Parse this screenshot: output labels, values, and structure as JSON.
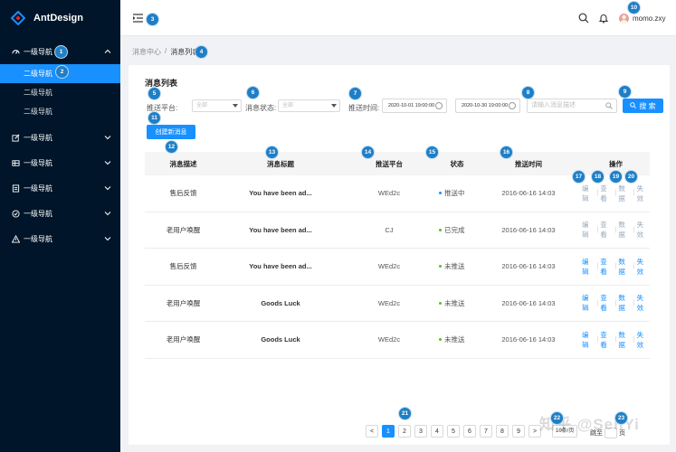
{
  "app": {
    "logo_text": "AntDesign",
    "brand_color": "#1890ff"
  },
  "sidebar": {
    "items": [
      {
        "label": "一级导航",
        "icon": "dashboard-icon",
        "expanded": true,
        "children": [
          {
            "label": "二级导航",
            "active": true
          },
          {
            "label": "二级导航"
          },
          {
            "label": "二级导航"
          }
        ]
      },
      {
        "label": "一级导航",
        "icon": "edit-icon"
      },
      {
        "label": "一级导航",
        "icon": "table-icon"
      },
      {
        "label": "一级导航",
        "icon": "profile-icon"
      },
      {
        "label": "一级导航",
        "icon": "check-circle-icon"
      },
      {
        "label": "一级导航",
        "icon": "warning-icon"
      }
    ]
  },
  "header": {
    "username": "momo.zxy"
  },
  "breadcrumb": {
    "parent": "消息中心",
    "separator": "/",
    "current": "消息列表"
  },
  "page": {
    "title": "消息列表"
  },
  "filters": {
    "platform_label": "推送平台:",
    "platform_placeholder": "全部",
    "status_label": "消息状态:",
    "status_placeholder": "全部",
    "time_label": "推送时间:",
    "start_time": "2020-10-01 19:00:00",
    "end_time": "2020-10-30 19:00:00",
    "search_placeholder": "请输入消息描述",
    "search_button": "搜 索"
  },
  "create_button": "创建新消息",
  "table": {
    "columns": [
      "消息描述",
      "消息标题",
      "推送平台",
      "状态",
      "推送时间",
      "操作"
    ],
    "rows": [
      {
        "desc": "售后反馈",
        "title": "You have been ad...",
        "platform": "WEd2c",
        "status": "推送中",
        "status_color": "#1890ff",
        "time": "2016-06-16  14:03",
        "actions_dim": true
      },
      {
        "desc": "老用户唤醒",
        "title": "You have been ad...",
        "platform": "CJ",
        "status": "已完成",
        "status_color": "#52c41a",
        "time": "2016-06-16  14:03",
        "actions_dim": true
      },
      {
        "desc": "售后反馈",
        "title": "You have been ad...",
        "platform": "WEd2c",
        "status": "未推送",
        "status_color": "#52c41a",
        "time": "2016-06-16  14:03",
        "actions_dim": false
      },
      {
        "desc": "老用户唤醒",
        "title": "Goods Luck",
        "platform": "WEd2c",
        "status": "未推送",
        "status_color": "#52c41a",
        "time": "2016-06-16  14:03",
        "actions_dim": false
      },
      {
        "desc": "老用户唤醒",
        "title": "Goods Luck",
        "platform": "WEd2c",
        "status": "未推送",
        "status_color": "#52c41a",
        "time": "2016-06-16  14:03",
        "actions_dim": false
      }
    ],
    "actions": [
      "编辑",
      "查看",
      "数据",
      "失效"
    ]
  },
  "pagination": {
    "prev": "<",
    "pages": [
      "1",
      "2",
      "3",
      "4",
      "5",
      "6",
      "7",
      "8",
      "9"
    ],
    "next": ">",
    "current": 1,
    "page_size": "10条/页",
    "goto_label": "跳至",
    "goto_suffix": "页"
  },
  "watermark": "知乎 @SenYi",
  "markers": [
    "1",
    "2",
    "3",
    "4",
    "5",
    "6",
    "7",
    "8",
    "9",
    "10",
    "11",
    "12",
    "13",
    "14",
    "15",
    "16",
    "17",
    "18",
    "19",
    "20",
    "21",
    "22",
    "23"
  ]
}
